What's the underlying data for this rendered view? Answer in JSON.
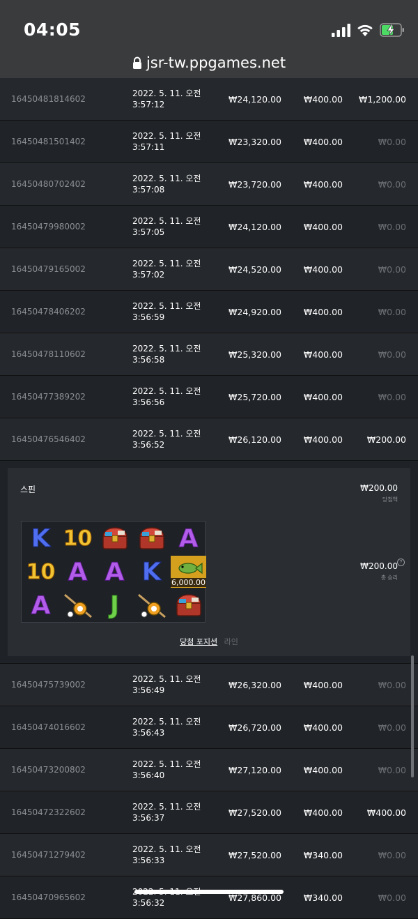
{
  "status": {
    "time": "04:05",
    "url": "jsr-tw.ppgames.net"
  },
  "rows_top": [
    {
      "id": "16450481814602",
      "date": "2022. 5. 11. 오전",
      "time": "3:57:12",
      "balance": "₩24,120.00",
      "bet": "₩400.00",
      "win": "₩1,200.00",
      "win_zero": false
    },
    {
      "id": "16450481501402",
      "date": "2022. 5. 11. 오전",
      "time": "3:57:11",
      "balance": "₩23,320.00",
      "bet": "₩400.00",
      "win": "₩0.00",
      "win_zero": true
    },
    {
      "id": "16450480702402",
      "date": "2022. 5. 11. 오전",
      "time": "3:57:08",
      "balance": "₩23,720.00",
      "bet": "₩400.00",
      "win": "₩0.00",
      "win_zero": true
    },
    {
      "id": "16450479980002",
      "date": "2022. 5. 11. 오전",
      "time": "3:57:05",
      "balance": "₩24,120.00",
      "bet": "₩400.00",
      "win": "₩0.00",
      "win_zero": true
    },
    {
      "id": "16450479165002",
      "date": "2022. 5. 11. 오전",
      "time": "3:57:02",
      "balance": "₩24,520.00",
      "bet": "₩400.00",
      "win": "₩0.00",
      "win_zero": true
    },
    {
      "id": "16450478406202",
      "date": "2022. 5. 11. 오전",
      "time": "3:56:59",
      "balance": "₩24,920.00",
      "bet": "₩400.00",
      "win": "₩0.00",
      "win_zero": true
    },
    {
      "id": "16450478110602",
      "date": "2022. 5. 11. 오전",
      "time": "3:56:58",
      "balance": "₩25,320.00",
      "bet": "₩400.00",
      "win": "₩0.00",
      "win_zero": true
    },
    {
      "id": "16450477389202",
      "date": "2022. 5. 11. 오전",
      "time": "3:56:56",
      "balance": "₩25,720.00",
      "bet": "₩400.00",
      "win": "₩0.00",
      "win_zero": true
    },
    {
      "id": "16450476546402",
      "date": "2022. 5. 11. 오전",
      "time": "3:56:52",
      "balance": "₩26,120.00",
      "bet": "₩400.00",
      "win": "₩200.00",
      "win_zero": false
    }
  ],
  "detail": {
    "spin_label": "스핀",
    "spin_amount": "₩200.00",
    "spin_sub": "당첨액",
    "total_amount": "₩200.00",
    "total_sub": "총 승리",
    "help": "?",
    "fish_value": "6,000.00",
    "grid": [
      [
        "K",
        "10",
        "chest",
        "chest",
        "A"
      ],
      [
        "10",
        "A",
        "A",
        "K",
        "fish"
      ],
      [
        "A",
        "rod",
        "J",
        "rod",
        "chest"
      ]
    ],
    "tab_active": "당첨 포지션",
    "tab_inactive": "라인"
  },
  "rows_bottom": [
    {
      "id": "16450475739002",
      "date": "2022. 5. 11. 오전",
      "time": "3:56:49",
      "balance": "₩26,320.00",
      "bet": "₩400.00",
      "win": "₩0.00",
      "win_zero": true
    },
    {
      "id": "16450474016602",
      "date": "2022. 5. 11. 오전",
      "time": "3:56:43",
      "balance": "₩26,720.00",
      "bet": "₩400.00",
      "win": "₩0.00",
      "win_zero": true
    },
    {
      "id": "16450473200802",
      "date": "2022. 5. 11. 오전",
      "time": "3:56:40",
      "balance": "₩27,120.00",
      "bet": "₩400.00",
      "win": "₩0.00",
      "win_zero": true
    },
    {
      "id": "16450472322602",
      "date": "2022. 5. 11. 오전",
      "time": "3:56:37",
      "balance": "₩27,520.00",
      "bet": "₩400.00",
      "win": "₩400.00",
      "win_zero": false
    },
    {
      "id": "16450471279402",
      "date": "2022. 5. 11. 오전",
      "time": "3:56:33",
      "balance": "₩27,520.00",
      "bet": "₩340.00",
      "win": "₩0.00",
      "win_zero": true
    },
    {
      "id": "16450470965602",
      "date": "2022. 5. 11. 오전",
      "time": "3:56:32",
      "balance": "₩27,860.00",
      "bet": "₩340.00",
      "win": "₩0.00",
      "win_zero": true
    }
  ]
}
